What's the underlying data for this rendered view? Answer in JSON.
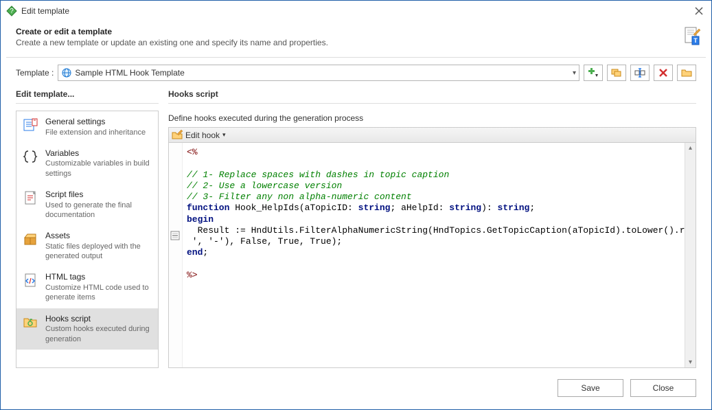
{
  "window": {
    "title": "Edit template"
  },
  "header": {
    "title": "Create or edit a template",
    "subtitle": "Create a new template or update an existing one and specify its name and properties."
  },
  "template": {
    "label": "Template :",
    "value": "Sample HTML Hook Template"
  },
  "sidebar": {
    "title": "Edit template",
    "items": [
      {
        "title": "General settings",
        "desc": "File extension and inheritance"
      },
      {
        "title": "Variables",
        "desc": "Customizable variables in build settings"
      },
      {
        "title": "Script files",
        "desc": "Used to generate the final documentation"
      },
      {
        "title": "Assets",
        "desc": "Static files deployed with the generated output"
      },
      {
        "title": "HTML tags",
        "desc": "Customize HTML code used to generate items"
      },
      {
        "title": "Hooks script",
        "desc": "Custom hooks executed during generation"
      }
    ]
  },
  "main": {
    "title": "Hooks script",
    "desc": "Define hooks executed during the generation process",
    "edit_hook_label": "Edit hook",
    "code": {
      "tag_open": "<%",
      "comment1": "// 1- Replace spaces with dashes in topic caption",
      "comment2": "// 2- Use a lowercase version",
      "comment3": "// 3- Filter any non alpha-numeric content",
      "kw_function": "function",
      "fn_name": " Hook_HelpIds(aTopicID: ",
      "type1": "string",
      "fn_mid": "; aHelpId: ",
      "type2": "string",
      "fn_close": "): ",
      "type3": "string",
      "semi": ";",
      "kw_begin": "begin",
      "line_result_a": "  Result := HndUtils.FilterAlphaNumericString(HndTopics.GetTopicCaption(aTopicId).toLower().replace('",
      "line_result_b": " ', '-'), False, True, True);",
      "kw_end": "end",
      "end_semi": ";",
      "tag_close": "%>"
    }
  },
  "footer": {
    "save": "Save",
    "close": "Close"
  }
}
